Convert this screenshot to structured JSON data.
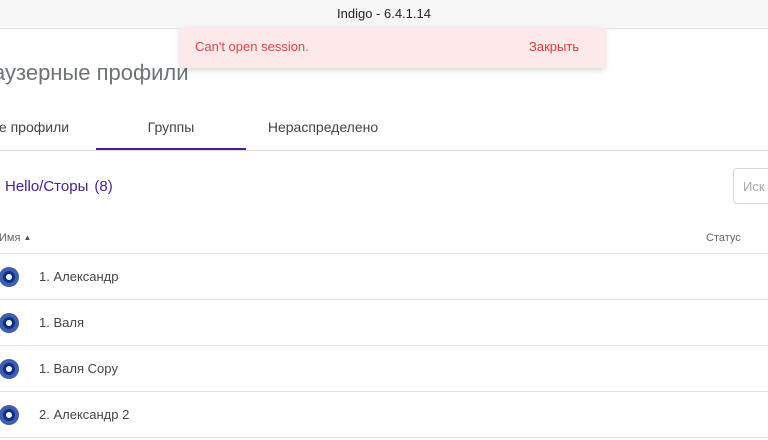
{
  "window": {
    "title": "Indigo - 6.4.1.14"
  },
  "page": {
    "title": "аузерные профили"
  },
  "tabs": [
    {
      "label": "е профили",
      "active": false
    },
    {
      "label": "Группы",
      "active": true
    },
    {
      "label": "Нераспределено",
      "active": false
    }
  ],
  "group": {
    "name": "Hello/Сторы",
    "count": "(8)"
  },
  "search": {
    "placeholder": "Иск"
  },
  "table": {
    "columns": {
      "name": "Имя",
      "status": "Статус"
    },
    "sort": {
      "column": "name",
      "direction": "asc"
    },
    "rows": [
      {
        "name": "1. Александр",
        "icon": "profile-ring-icon"
      },
      {
        "name": "1. Валя",
        "icon": "profile-ring-icon"
      },
      {
        "name": "1. Валя Copy",
        "icon": "profile-ring-icon"
      },
      {
        "name": "2. Александр 2",
        "icon": "profile-ring-icon"
      }
    ]
  },
  "toast": {
    "message": "Can't open session.",
    "close_label": "Закрыть"
  },
  "colors": {
    "accent": "#4b1f8f",
    "toast_bg": "#fde9ea",
    "toast_text": "#e0454b",
    "icon_blue": "#0f2f86"
  }
}
